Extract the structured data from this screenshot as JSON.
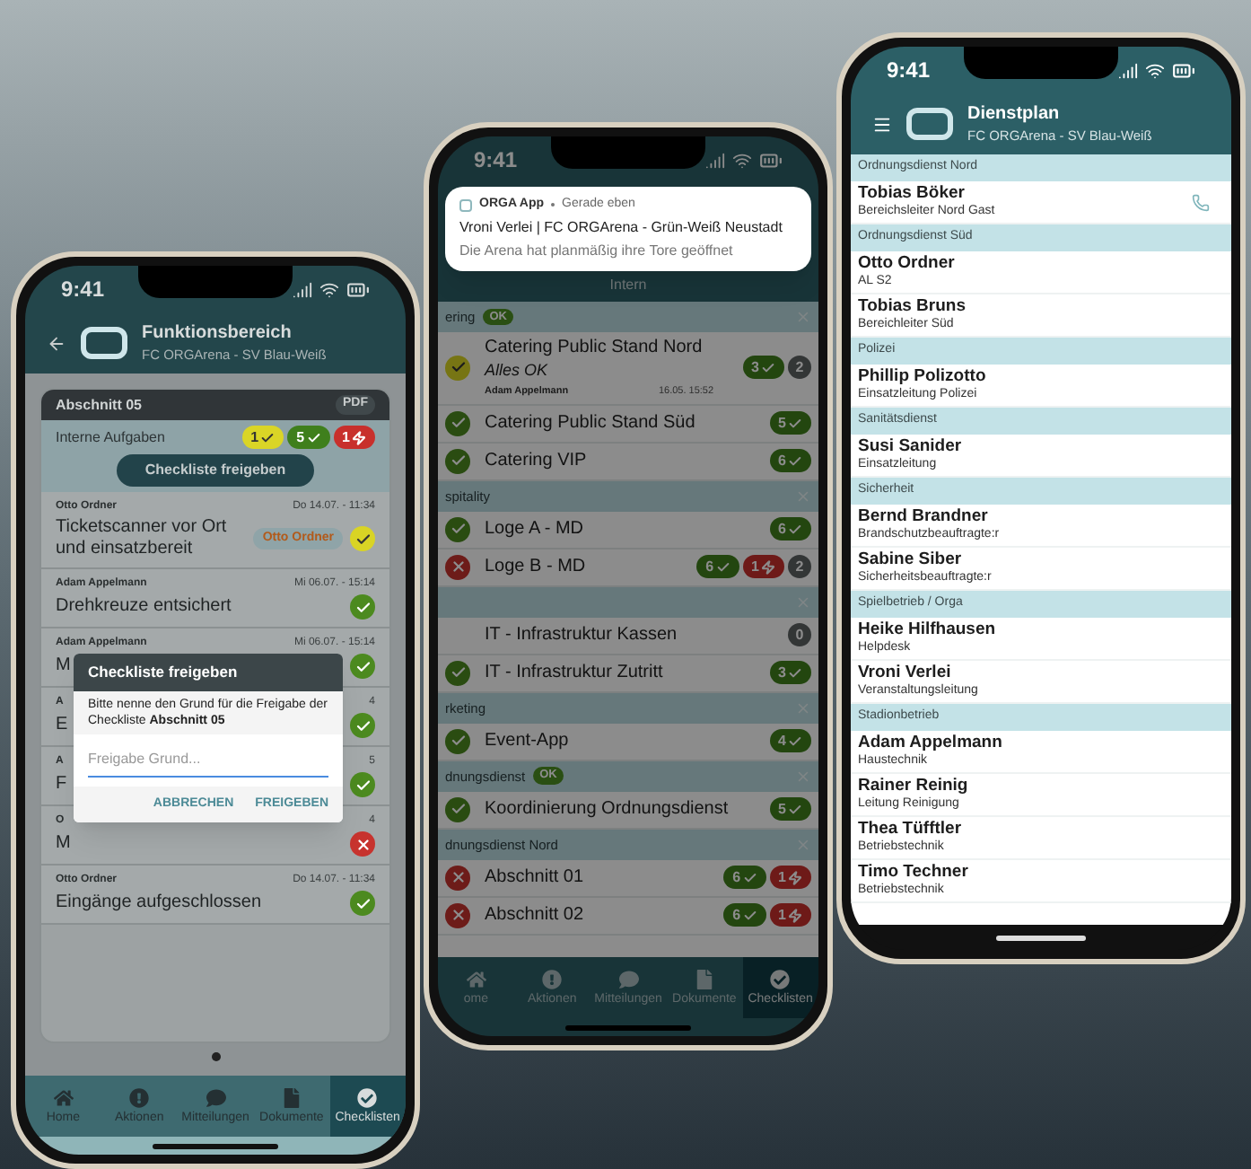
{
  "left_phone": {
    "status_bar": {
      "time": "9:41"
    },
    "header": {
      "title": "Funktionsbereich",
      "subtitle": "FC ORGArena - SV Blau-Weiß"
    },
    "card": {
      "title": "Abschnitt 05",
      "pdf": "PDF",
      "section_label": "Interne Aufgaben",
      "badges": [
        {
          "kind": "pending",
          "count": "1"
        },
        {
          "kind": "done",
          "count": "5"
        },
        {
          "kind": "alert",
          "count": "1"
        }
      ],
      "release_button": "Checkliste freigeben",
      "items": [
        {
          "author": "Otto Ordner",
          "date": "Do 14.07. - 11:34",
          "title": "Ticketscanner vor Ort und einsatzbereit",
          "tag": "Otto Ordner",
          "kind": "pending"
        },
        {
          "author": "Adam Appelmann",
          "date": "Mi 06.07. - 15:14",
          "title": "Drehkreuze entsichert",
          "kind": "done"
        }
      ],
      "covered_items": [
        {
          "author": "Adam Appelmann",
          "date": "Mi 06.07. - 15:14",
          "title": "M",
          "kind": "done"
        },
        {
          "author": "A",
          "date": "4",
          "title": "E",
          "kind": "done"
        },
        {
          "author": "A",
          "date": "5",
          "title": "F",
          "kind": "done"
        },
        {
          "author": "O",
          "date": "4",
          "title": "M",
          "kind": "alert"
        }
      ],
      "last_items": [
        {
          "author": "Otto Ordner",
          "date": "Do 14.07. - 11:34",
          "title": "Eingänge aufgeschlossen",
          "kind": "done"
        }
      ]
    },
    "dialog": {
      "title": "Checkliste freigeben",
      "message": "Bitte nenne den Grund für die Freigabe der Checkliste **Abschnitt 05**",
      "placeholder": "Freigabe Grund...",
      "buttons": [
        "ABBRECHEN",
        "FREIGEBEN"
      ]
    },
    "nav": [
      {
        "label": "Home",
        "selected": false
      },
      {
        "label": "Aktionen",
        "selected": false
      },
      {
        "label": "Mitteilungen",
        "selected": false
      },
      {
        "label": "Dokumente",
        "selected": false
      },
      {
        "label": "Checklisten",
        "selected": true
      }
    ]
  },
  "middle_phone": {
    "status_bar": {
      "time": "9:41"
    },
    "notification": {
      "app": "ORGA App",
      "time": "Gerade eben",
      "title": "Vroni Verlei | FC ORGArena - Grün-Weiß Neustadt",
      "body": "Die Arena hat planmäßig ihre Tore geöffnet"
    },
    "subheading": "Intern",
    "sections": [
      {
        "label": "ering",
        "ok": "OK",
        "items": [
          {
            "title": "Catering Public Stand Nord",
            "kind": "pending",
            "note": "Alles OK",
            "author": "Adam Appelmann",
            "time": "16.05. 15:52",
            "badges": [
              {
                "kind": "done",
                "count": "3"
              },
              {
                "kind": "open",
                "count": "2"
              }
            ]
          },
          {
            "title": "Catering Public Stand Süd",
            "kind": "done",
            "badges": [
              {
                "kind": "done",
                "count": "5"
              }
            ]
          },
          {
            "title": "Catering VIP",
            "kind": "done",
            "badges": [
              {
                "kind": "done",
                "count": "6"
              }
            ]
          }
        ]
      },
      {
        "label": "spitality",
        "items": [
          {
            "title": "Loge A - MD",
            "kind": "done",
            "badges": [
              {
                "kind": "done",
                "count": "6"
              }
            ]
          },
          {
            "title": "Loge B - MD",
            "kind": "alert",
            "badges": [
              {
                "kind": "done",
                "count": "6"
              },
              {
                "kind": "alert",
                "count": "1"
              },
              {
                "kind": "open",
                "count": "2"
              }
            ]
          }
        ]
      },
      {
        "items": [
          {
            "title": "IT - Infrastruktur Kassen",
            "kind": "none",
            "badges": [
              {
                "kind": "open",
                "count": "0"
              }
            ]
          },
          {
            "title": "IT - Infrastruktur Zutritt",
            "kind": "done",
            "badges": [
              {
                "kind": "done",
                "count": "3"
              }
            ]
          }
        ]
      },
      {
        "label": "rketing",
        "items": [
          {
            "title": "Event-App",
            "kind": "done",
            "badges": [
              {
                "kind": "done",
                "count": "4"
              }
            ]
          }
        ]
      },
      {
        "label": "dnungsdienst",
        "ok": "OK",
        "items": [
          {
            "title": "Koordinierung Ordnungsdienst",
            "kind": "done",
            "badges": [
              {
                "kind": "done",
                "count": "5"
              }
            ]
          }
        ]
      },
      {
        "label": "dnungsdienst Nord",
        "items": [
          {
            "title": "Abschnitt 01",
            "kind": "alert",
            "badges": [
              {
                "kind": "done",
                "count": "6"
              },
              {
                "kind": "alert",
                "count": "1"
              }
            ]
          },
          {
            "title": "Abschnitt 02",
            "kind": "alert",
            "badges": [
              {
                "kind": "done",
                "count": "6"
              },
              {
                "kind": "alert",
                "count": "1"
              }
            ]
          }
        ]
      }
    ],
    "nav": [
      {
        "label": "ome",
        "selected": false
      },
      {
        "label": "Aktionen",
        "selected": false
      },
      {
        "label": "Mitteilungen",
        "selected": false
      },
      {
        "label": "Dokumente",
        "selected": false
      },
      {
        "label": "Checklisten",
        "selected": true
      }
    ]
  },
  "right_phone": {
    "status_bar": {
      "time": "9:41"
    },
    "header": {
      "title": "Dienstplan",
      "subtitle": "FC ORGArena - SV Blau-Weiß"
    },
    "groups": [
      {
        "label": "Ordnungsdienst Nord",
        "people": [
          {
            "name": "Tobias Böker",
            "role": "Bereichsleiter Nord Gast",
            "phone": true
          }
        ]
      },
      {
        "label": "Ordnungsdienst Süd",
        "people": [
          {
            "name": "Otto Ordner",
            "role": "AL S2",
            "phone": false
          },
          {
            "name": "Tobias Bruns",
            "role": "Bereichleiter Süd",
            "phone": false
          }
        ]
      },
      {
        "label": "Polizei",
        "people": [
          {
            "name": "Phillip Polizotto",
            "role": "Einsatzleitung Polizei",
            "phone": false
          }
        ]
      },
      {
        "label": "Sanitätsdienst",
        "people": [
          {
            "name": "Susi Sanider",
            "role": "Einsatzleitung",
            "phone": false
          }
        ]
      },
      {
        "label": "Sicherheit",
        "people": [
          {
            "name": "Bernd Brandner",
            "role": "Brandschutzbeauftragte:r",
            "phone": false
          },
          {
            "name": "Sabine Siber",
            "role": "Sicherheitsbeauftragte:r",
            "phone": false
          }
        ]
      },
      {
        "label": "Spielbetrieb / Orga",
        "people": [
          {
            "name": "Heike Hilfhausen",
            "role": "Helpdesk",
            "phone": false
          },
          {
            "name": "Vroni Verlei",
            "role": "Veranstaltungsleitung",
            "phone": false
          }
        ]
      },
      {
        "label": "Stadionbetrieb",
        "people": [
          {
            "name": "Adam Appelmann",
            "role": "Haustechnik",
            "phone": false
          },
          {
            "name": "Rainer Reinig",
            "role": "Leitung Reinigung",
            "phone": false
          },
          {
            "name": "Thea Tüfftler",
            "role": "Betriebstechnik",
            "phone": false
          },
          {
            "name": "Timo Techner",
            "role": "Betriebstechnik",
            "phone": false
          }
        ]
      }
    ]
  }
}
